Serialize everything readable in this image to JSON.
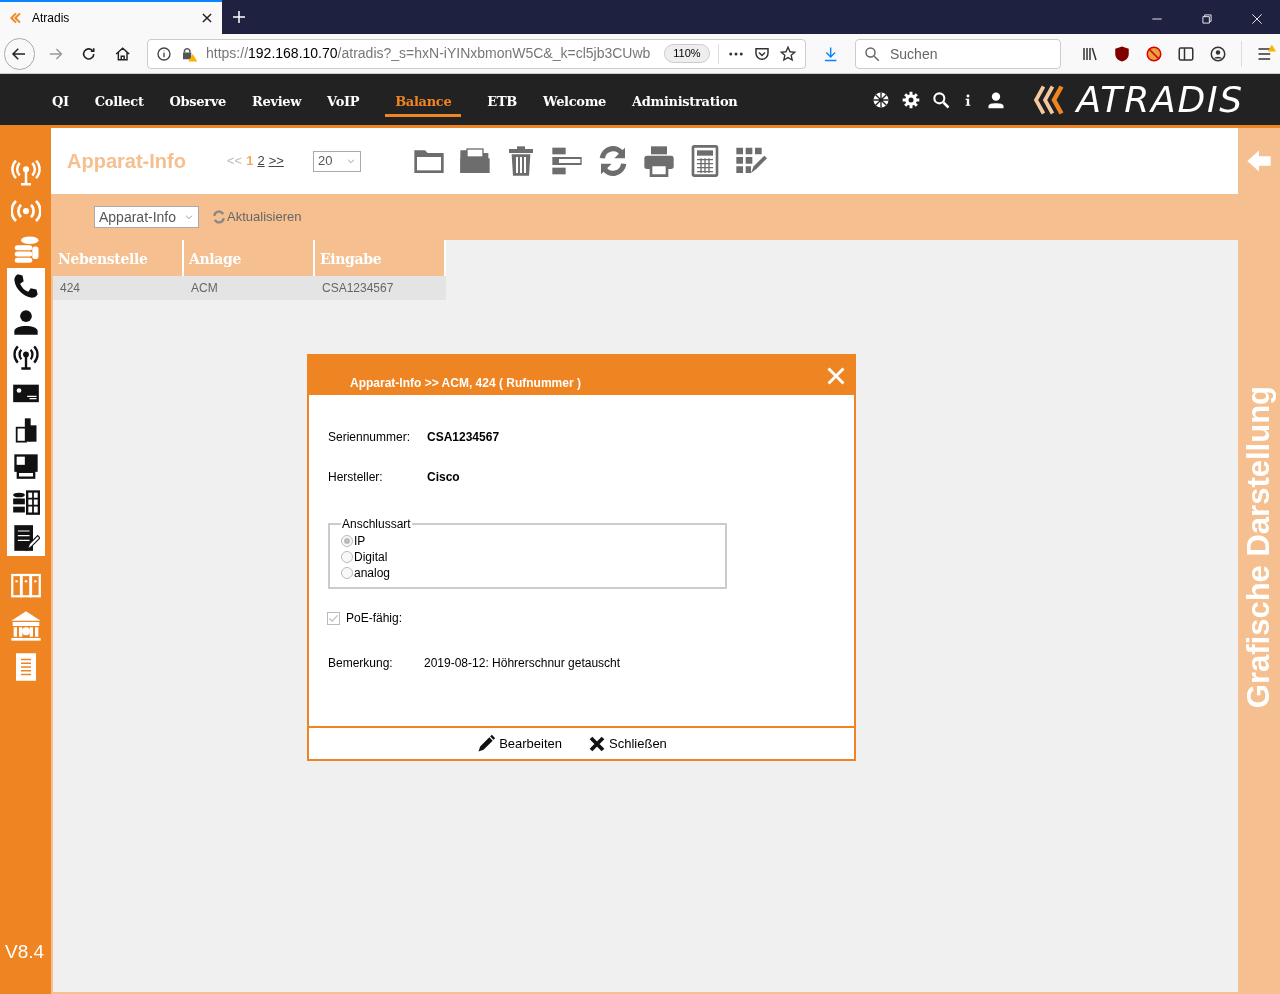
{
  "browser": {
    "tab_title": "Atradis",
    "url_prefix": "https://",
    "url_host": "192.168.10.70",
    "url_rest": "/atradis?_s=hxN-iYINxbmonW5C&_k=cl5jb3CUwb",
    "zoom": "110%",
    "search_placeholder": "Suchen"
  },
  "nav": [
    {
      "label": "QI",
      "selected": false
    },
    {
      "label": "Collect",
      "selected": false
    },
    {
      "label": "Observe",
      "selected": false
    },
    {
      "label": "Review",
      "selected": false
    },
    {
      "label": "VoIP",
      "selected": false
    },
    {
      "label": "Balance",
      "selected": true
    },
    {
      "label": "ETB",
      "selected": false
    },
    {
      "label": "Welcome",
      "selected": false
    },
    {
      "label": "Administration",
      "selected": false
    }
  ],
  "logo": "ATRADIS",
  "page_title": "Apparat-Info",
  "pagination": {
    "prev": "<<",
    "pages": [
      {
        "label": "1",
        "selected": true
      },
      {
        "label": "2",
        "selected": false
      }
    ],
    "next": ">>"
  },
  "page_size": "20",
  "view_select": "Apparat-Info",
  "refresh": "Aktualisieren",
  "table": {
    "columns": [
      "Nebenstelle",
      "Anlage",
      "Eingabe"
    ],
    "rows": [
      [
        "424",
        "ACM",
        "CSA1234567"
      ]
    ]
  },
  "version": "V8.4",
  "right_panel": "Grafische Darstellung",
  "dialog": {
    "title": "Apparat-Info >> ACM, 424 ( Rufnummer )",
    "fields": [
      {
        "label": "Seriennummer:",
        "value": "CSA1234567"
      },
      {
        "label": "Hersteller:",
        "value": "Cisco"
      }
    ],
    "fieldset": {
      "legend": "Anschlussart",
      "options": [
        {
          "label": "IP",
          "selected": true
        },
        {
          "label": "Digital",
          "selected": false
        },
        {
          "label": "analog",
          "selected": false
        }
      ]
    },
    "checkbox": {
      "label": "PoE-fähig:",
      "checked": true
    },
    "remark": {
      "label": "Bemerkung:",
      "value": "2019-08-12: Höhrerschnur getauscht"
    },
    "buttons": [
      {
        "kind": "edit",
        "label": "Bearbeiten"
      },
      {
        "kind": "close",
        "label": "Schließen"
      }
    ]
  }
}
